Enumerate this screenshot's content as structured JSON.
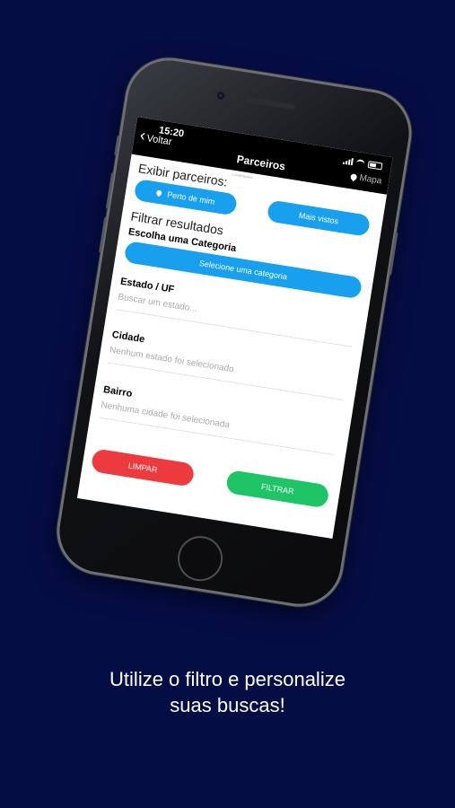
{
  "navbar": {
    "time": "15:20",
    "back_label": "Voltar",
    "title": "Parceiros",
    "map_label": "Mapa"
  },
  "screen": {
    "tiny_label": "Localizações",
    "show_partners_label": "Exibir parceiros:",
    "near_me_label": "Perto de mim",
    "most_viewed_label": "Mais vistos",
    "filter_results_label": "Filtrar resultados",
    "category_heading": "Escolha uma Categoria",
    "category_button_label": "Selecione uma categoria",
    "fields": [
      {
        "label": "Estado / UF",
        "placeholder": "Buscar um estado..."
      },
      {
        "label": "Cidade",
        "placeholder": "Nenhum estado foi selecionado"
      },
      {
        "label": "Bairro",
        "placeholder": "Nenhuma cidade foi selecionada"
      }
    ],
    "clear_label": "LIMPAR",
    "filter_label": "FILTRAR"
  },
  "caption": {
    "line1": "Utilize o filtro e personalize",
    "line2": "suas buscas!"
  },
  "colors": {
    "background": "#050d45",
    "accent_blue": "#18a0ef",
    "clear_red": "#ec3a3f",
    "filter_green": "#1fc467"
  }
}
